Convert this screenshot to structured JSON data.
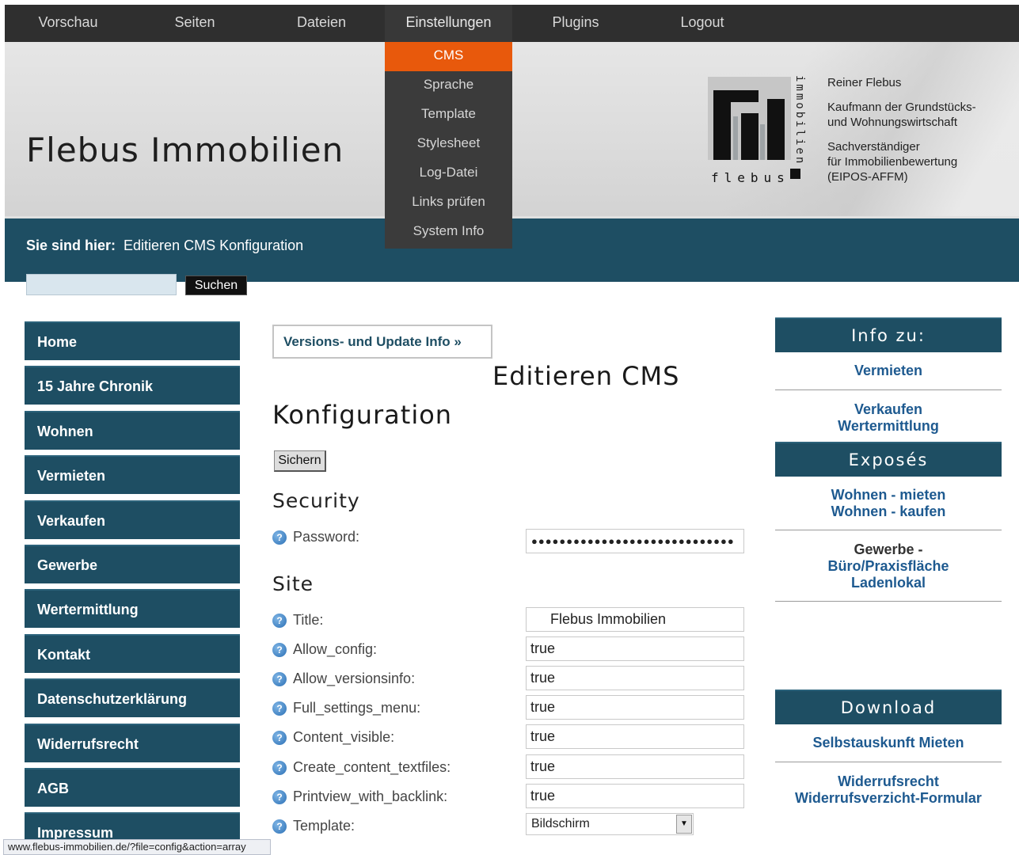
{
  "topbar": {
    "items": [
      "Vorschau",
      "Seiten",
      "Dateien",
      "Einstellungen",
      "Plugins",
      "Logout"
    ],
    "active": "Einstellungen"
  },
  "dropdown": {
    "items": [
      "CMS",
      "Sprache",
      "Template",
      "Stylesheet",
      "Log-Datei",
      "Links prüfen",
      "System Info"
    ],
    "current": "CMS"
  },
  "header": {
    "site_title": "Flebus Immobilien",
    "logo": {
      "mark": "fi",
      "word_horizontal": "flebus",
      "word_vertical": "immobilien"
    },
    "owner": {
      "name": "Reiner Flebus",
      "role_1a": "Kaufmann der Grundstücks-",
      "role_1b": "und Wohnungswirtschaft",
      "role_2a": "Sachverständiger",
      "role_2b": "für Immobilienbewertung",
      "role_2c": "(EIPOS-AFFM)"
    }
  },
  "breadcrumb": {
    "prefix": "Sie sind hier:",
    "current": "Editieren CMS Konfiguration"
  },
  "search": {
    "value": "",
    "button": "Suchen"
  },
  "leftnav": [
    "Home",
    "15 Jahre Chronik",
    "Wohnen",
    "Vermieten",
    "Verkaufen",
    "Gewerbe",
    "Wertermittlung",
    "Kontakt",
    "Datenschutzerklärung",
    "Widerrufsrecht",
    "AGB",
    "Impressum"
  ],
  "main": {
    "version_button": "Versions- und Update Info »",
    "heading_line1": "Editieren CMS",
    "heading_line2": "Konfiguration",
    "save_button": "Sichern",
    "section_security": "Security",
    "section_site": "Site",
    "password_label": "Password:",
    "password_value": "●●●●●●●●●●●●●●●●●●●●●●●●●●●●●",
    "fields": [
      {
        "label": "Title:",
        "value": "Flebus Immobilien"
      },
      {
        "label": "Allow_config:",
        "value": "true"
      },
      {
        "label": "Allow_versionsinfo:",
        "value": "true"
      },
      {
        "label": "Full_settings_menu:",
        "value": "true"
      },
      {
        "label": "Content_visible:",
        "value": "true"
      },
      {
        "label": "Create_content_textfiles:",
        "value": "true"
      },
      {
        "label": "Printview_with_backlink:",
        "value": "true"
      }
    ],
    "template_label": "Template:",
    "template_value": "Bildschirm",
    "help_glyph": "?"
  },
  "rightcol": {
    "info_heading": "Info zu:",
    "info_link_1": "Vermieten",
    "info_link_2": "Verkaufen",
    "info_link_3": "Wertermittlung",
    "exposes_heading": "Exposés",
    "exposes_link_1": "Wohnen - mieten",
    "exposes_link_2": "Wohnen - kaufen",
    "gewerbe_text": "Gewerbe -",
    "gewerbe_link_1": "Büro/Praxisfläche",
    "gewerbe_link_2": "Ladenlokal",
    "download_heading": "Download",
    "download_link_1": "Selbstauskunft Mieten",
    "download_link_2": "Widerrufsrecht",
    "download_link_3": "Widerrufsverzicht-Formular"
  },
  "statusbar": {
    "url": "www.flebus-immobilien.de/?file=config&action=array"
  },
  "colors": {
    "accent": "#e8590c",
    "primary": "#1e4e63",
    "link": "#1e5a90",
    "topbar": "#2f2f2f"
  }
}
